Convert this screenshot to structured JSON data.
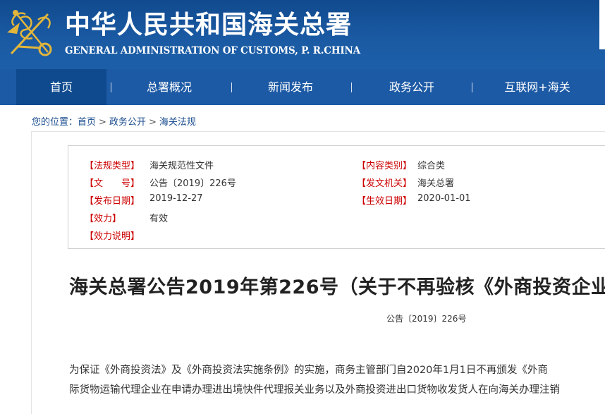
{
  "header": {
    "title": "中华人民共和国海关总署",
    "subtitle": "GENERAL ADMINISTRATION OF CUSTOMS, P. R.CHINA",
    "emblem_icon": "customs-emblem-icon"
  },
  "nav": {
    "items": [
      {
        "label": "首页",
        "active": true
      },
      {
        "label": "总署概况"
      },
      {
        "label": "新闻发布"
      },
      {
        "label": "政务公开"
      },
      {
        "label": "互联网+海关"
      }
    ],
    "separator": "|"
  },
  "breadcrumb": {
    "prefix": "您的位置：",
    "items": [
      "首页",
      "政务公开",
      "海关法规"
    ],
    "sep": ">"
  },
  "meta": {
    "type_label": "【法规类型】",
    "type_value": "海关规范性文件",
    "category_label": "【内容类别】",
    "category_value": "综合类",
    "docno_label": "【文　　号】",
    "docno_value": "公告〔2019〕226号",
    "issuer_label": "【发文机关】",
    "issuer_value": "海关总署",
    "pubdate_label": "【发布日期】",
    "pubdate_value": "2019-12-27",
    "effdate_label": "【生效日期】",
    "effdate_value": "2020-01-01",
    "validity_label": "【效力】",
    "validity_value": "有效",
    "validity_note_label": "【效力说明】"
  },
  "article": {
    "title": "海关总署公告2019年第226号（关于不再验核《外商投资企业",
    "doc_number": "公告〔2019〕226号",
    "paragraph_line1": "为保证《外商投资法》及《外商投资法实施条例》的实施，商务主管部门自2020年1月1日不再颁发《外商",
    "paragraph_line2": "际货物运输代理企业在申请办理进出境快件代理报关业务以及外商投资进出口货物收发货人在向海关办理注销"
  },
  "colors": {
    "header_blue": "#1a5aa3",
    "nav_blue": "#1d5aa5",
    "active_nav": "#0f4a8f",
    "label_red": "#cc0000",
    "link_blue": "#1a4c8e"
  }
}
